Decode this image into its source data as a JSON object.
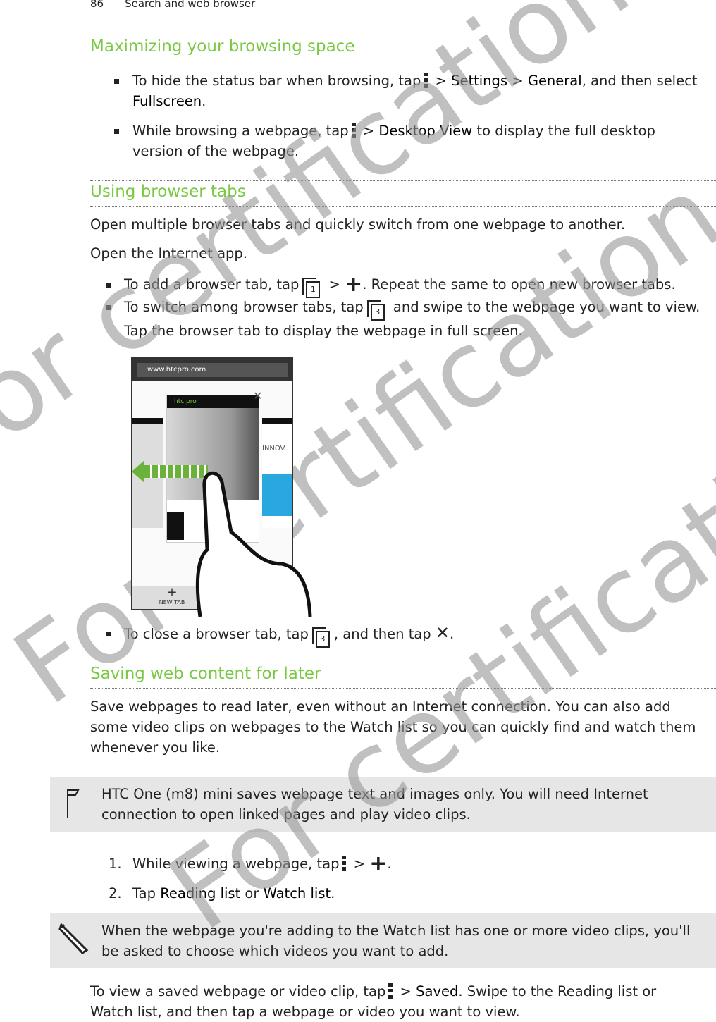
{
  "header": {
    "page_number": "86",
    "chapter": "Search and web browser"
  },
  "section1": {
    "title": "Maximizing your browsing space",
    "bullet1": {
      "pre": "To hide the status bar when browsing, tap",
      "mid1": " > ",
      "settings": "Settings",
      "mid2": " > ",
      "general": "General",
      "post1": ", and then select ",
      "fullscreen": "Fullscreen",
      "post2": "."
    },
    "bullet2": {
      "pre": "While browsing a webpage, tap",
      "mid": " > ",
      "desktop": "Desktop View",
      "post": " to display the full desktop version of the webpage."
    }
  },
  "section2": {
    "title": "Using browser tabs",
    "intro": "Open multiple browser tabs and quickly switch from one webpage to another.",
    "open": "Open the Internet app.",
    "bullet1": {
      "pre": "To add a browser tab, tap",
      "mid": " > ",
      "post": ". Repeat the same to open new browser tabs.",
      "tab_count": "1"
    },
    "bullet2": {
      "pre": "To switch among browser tabs, tap",
      "post": " and swipe to the webpage you want to view. Tap the browser tab to display the webpage in full screen.",
      "tab_count": "3"
    },
    "screenshot": {
      "url": "www.htcpro.com",
      "new_tab": "NEW TAB",
      "brand": "htc pro",
      "side_text": "INNOV"
    },
    "bullet3": {
      "pre": "To close a browser tab, tap",
      "mid": ", and then tap",
      "post": ".",
      "tab_count": "3"
    }
  },
  "section3": {
    "title": "Saving web content for later",
    "intro": "Save webpages to read later, even without an Internet connection. You can also add some video clips on webpages to the Watch list so you can quickly find and watch them whenever you like.",
    "note1": "HTC One (m8) mini saves webpage text and images only. You will need Internet connection to open linked pages and play video clips.",
    "step1": {
      "num": "1.",
      "pre": "While viewing a webpage, tap",
      "mid": " > ",
      "post": "."
    },
    "step2": {
      "num": "2.",
      "pre": "Tap ",
      "reading": "Reading list",
      "mid": " or ",
      "watch": "Watch list",
      "post": "."
    },
    "note2": "When the webpage you're adding to the Watch list has one or more video clips, you'll be asked to choose which videos you want to add.",
    "outro": {
      "pre": "To view a saved webpage or video clip, tap",
      "mid": " > ",
      "saved": "Saved",
      "post": ". Swipe to the Reading list or Watch list, and then tap a webpage or video you want to view."
    }
  },
  "watermark": "For certification only"
}
